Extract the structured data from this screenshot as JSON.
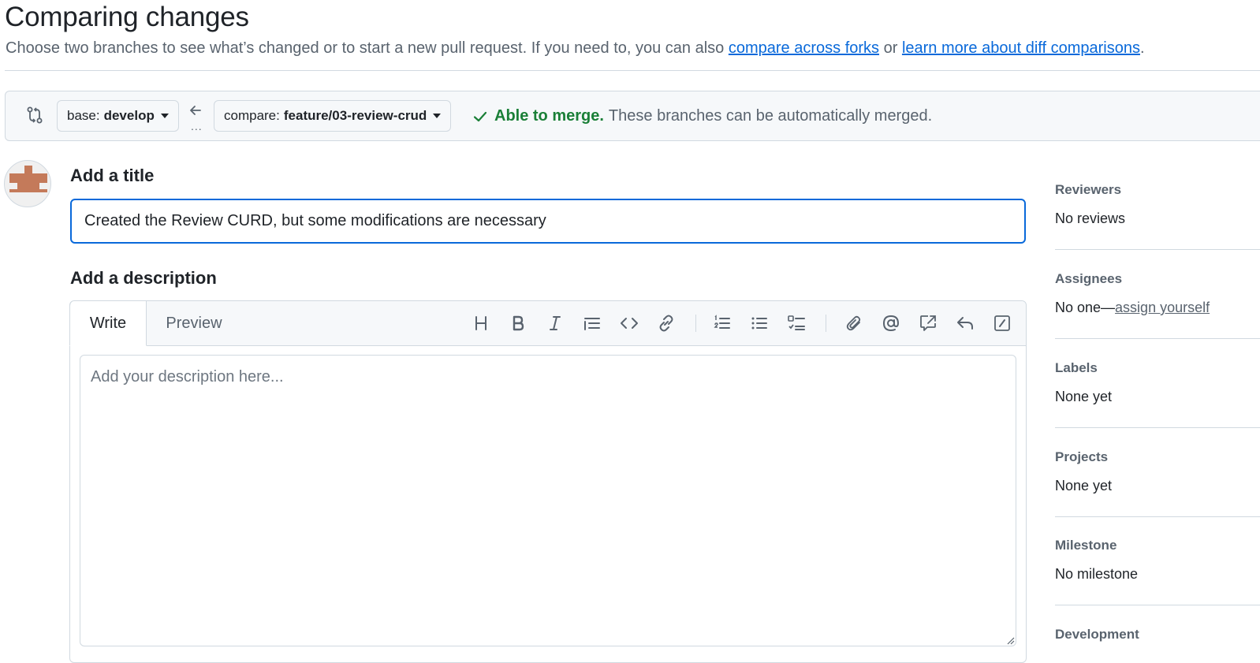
{
  "header": {
    "title": "Comparing changes",
    "subtitle_prefix": "Choose two branches to see what’s changed or to start a new pull request. If you need to, you can also ",
    "link_forks": "compare across forks",
    "subtitle_or": " or ",
    "link_learn": "learn more about diff comparisons",
    "subtitle_end": "."
  },
  "range": {
    "base_label": "base:",
    "base_value": "develop",
    "arrow_dots": "...",
    "compare_label": "compare:",
    "compare_value": "feature/03-review-crud",
    "merge_ok": "Able to merge.",
    "merge_rest": "These branches can be automatically merged."
  },
  "form": {
    "title_heading": "Add a title",
    "title_value": "Created the Review CURD, but some modifications are necessary",
    "desc_heading": "Add a description",
    "tab_write": "Write",
    "tab_preview": "Preview",
    "desc_placeholder": "Add your description here..."
  },
  "toolbar": [
    "heading-icon",
    "bold-icon",
    "italic-icon",
    "quote-icon",
    "code-icon",
    "link-icon",
    "ordered-list-icon",
    "unordered-list-icon",
    "task-list-icon",
    "attach-icon",
    "mention-icon",
    "cross-reference-icon",
    "reply-icon",
    "slash-commands-icon"
  ],
  "sidebar": {
    "reviewers": {
      "heading": "Reviewers",
      "value": "No reviews"
    },
    "assignees": {
      "heading": "Assignees",
      "value_prefix": "No one—",
      "link": "assign yourself"
    },
    "labels": {
      "heading": "Labels",
      "value": "None yet"
    },
    "projects": {
      "heading": "Projects",
      "value": "None yet"
    },
    "milestone": {
      "heading": "Milestone",
      "value": "No milestone"
    },
    "development": {
      "heading": "Development"
    }
  },
  "colors": {
    "accent": "#0969da",
    "success": "#1a7f37",
    "muted": "#59636e",
    "border": "#d1d9e0",
    "avatar": "#c47a5a"
  }
}
